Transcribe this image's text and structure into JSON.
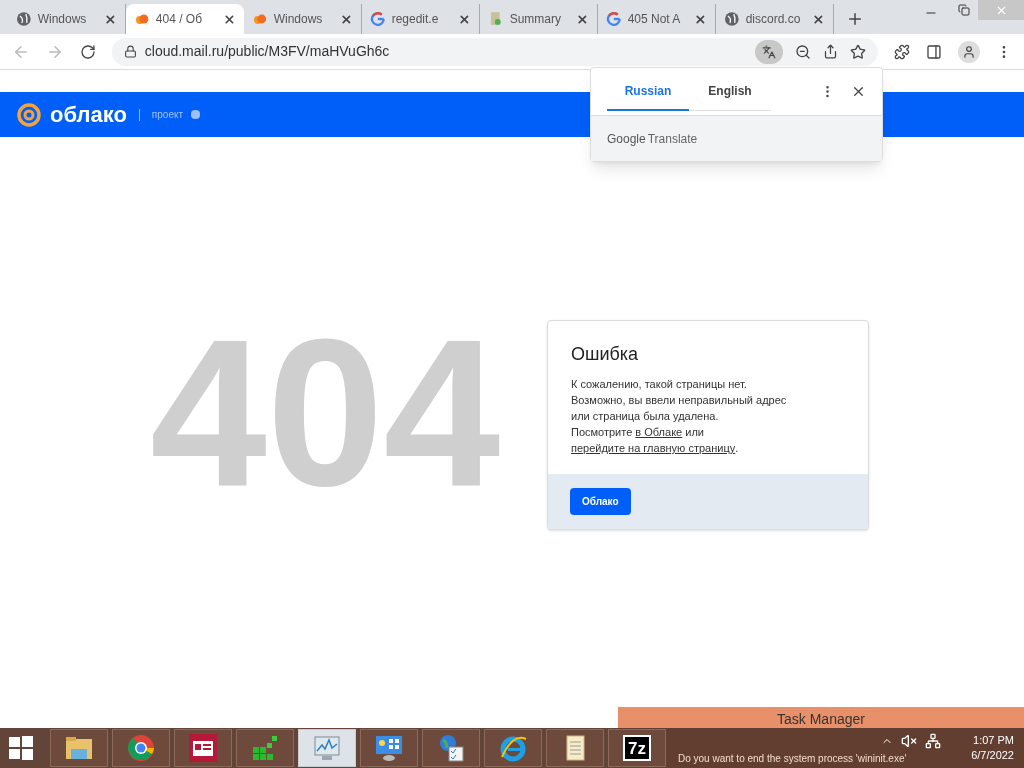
{
  "tabs": [
    {
      "title": "Windows",
      "selected": false
    },
    {
      "title": "404 / Об",
      "selected": true
    },
    {
      "title": "Windows",
      "selected": false
    },
    {
      "title": "regedit.e",
      "selected": false
    },
    {
      "title": "Summary",
      "selected": false
    },
    {
      "title": "405 Not A",
      "selected": false
    },
    {
      "title": "discord.co",
      "selected": false
    }
  ],
  "address_bar": {
    "url": "cloud.mail.ru/public/M3FV/maHVuGh6c"
  },
  "translate_popup": {
    "languages": [
      {
        "label": "Russian",
        "selected": true
      },
      {
        "label": "English",
        "selected": false
      }
    ],
    "brand": "Google",
    "product": "Translate"
  },
  "site_header": {
    "logo": "облако",
    "tagline": "проект"
  },
  "error_code": "404",
  "error_card": {
    "title": "Ошибка",
    "lines": [
      "К сожалению, такой страницы нет.",
      "Возможно, вы ввели неправильный адрес",
      "или страница была удалена."
    ],
    "prefix": "Посмотрите ",
    "link1": "в Облаке",
    "middle": " или ",
    "link2": "перейдите на главную страницу",
    "suffix": ".",
    "button": "Облако"
  },
  "taskbar": {
    "apps": [
      {
        "active": false
      },
      {
        "active": false
      },
      {
        "active": false
      },
      {
        "active": false
      },
      {
        "active": true
      },
      {
        "active": false
      },
      {
        "active": false
      },
      {
        "active": false
      },
      {
        "active": false
      },
      {
        "active": false
      }
    ],
    "seven_zip_label": "7z",
    "time": "1:07 PM",
    "date": "6/7/2022"
  },
  "dialog": {
    "title": "Task Manager",
    "message": "Do you want to end the system process 'wininit.exe'"
  }
}
